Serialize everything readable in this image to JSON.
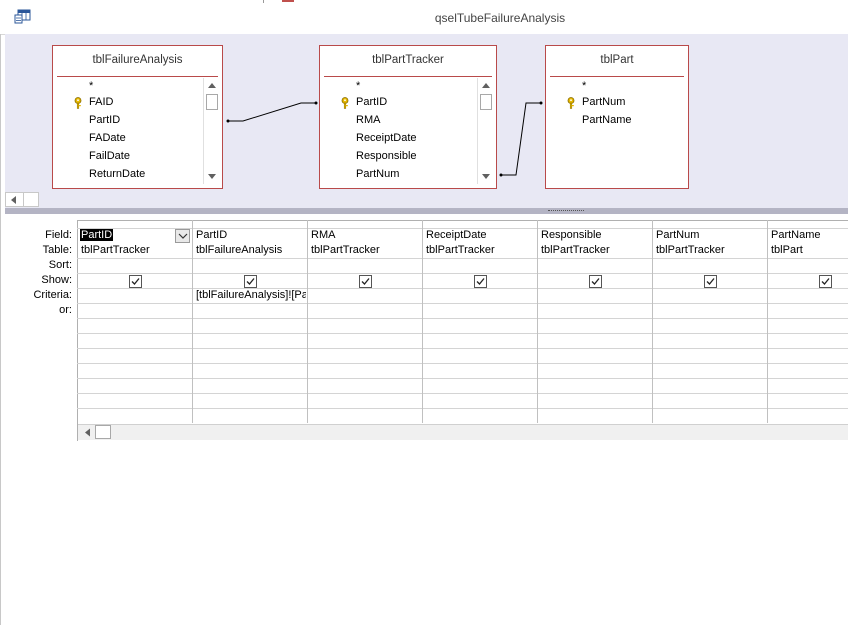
{
  "window": {
    "title": "qselTubeFailureAnalysis",
    "icon": "query-design-icon"
  },
  "tables": [
    {
      "name": "tblFailureAnalysis",
      "fields": [
        "*",
        "FAID",
        "PartID",
        "FADate",
        "FailDate",
        "ReturnDate"
      ],
      "key_field": "FAID"
    },
    {
      "name": "tblPartTracker",
      "fields": [
        "*",
        "PartID",
        "RMA",
        "ReceiptDate",
        "Responsible",
        "PartNum"
      ],
      "key_field": "PartID"
    },
    {
      "name": "tblPart",
      "fields": [
        "*",
        "PartNum",
        "PartName"
      ],
      "key_field": "PartNum"
    }
  ],
  "grid": {
    "row_labels": [
      "Field:",
      "Table:",
      "Sort:",
      "Show:",
      "Criteria:",
      "or:"
    ],
    "columns": [
      {
        "field": "PartID",
        "table": "tblPartTracker",
        "show": true,
        "criteria": ""
      },
      {
        "field": "PartID",
        "table": "tblFailureAnalysis",
        "show": true,
        "criteria": "[tblFailureAnalysis]![PartID]"
      },
      {
        "field": "RMA",
        "table": "tblPartTracker",
        "show": true,
        "criteria": ""
      },
      {
        "field": "ReceiptDate",
        "table": "tblPartTracker",
        "show": true,
        "criteria": ""
      },
      {
        "field": "Responsible",
        "table": "tblPartTracker",
        "show": true,
        "criteria": ""
      },
      {
        "field": "PartNum",
        "table": "tblPartTracker",
        "show": true,
        "criteria": ""
      },
      {
        "field": "PartName",
        "table": "tblPart",
        "show": true,
        "criteria": ""
      }
    ]
  },
  "colors": {
    "table_border": "#b94a4a",
    "upper_pane_bg": "#e8e8f4"
  }
}
